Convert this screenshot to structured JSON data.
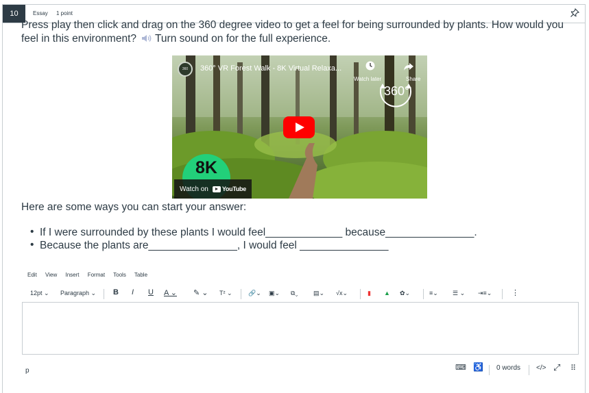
{
  "question": {
    "number": "10",
    "type": "Essay",
    "points": "1 point"
  },
  "prompt": {
    "line1": "Press play then click and drag on the 360 degree video to get a feel for being surrounded by plants.  How would you",
    "line2_a": "feel in this environment?",
    "line2_b": "Turn sound on for the full experience."
  },
  "video": {
    "title": "360° VR Forest Walk - 8K Virtual Relaxa...",
    "channel_badge": "360",
    "watch_later": "Watch later",
    "share": "Share",
    "badge_360": "360°",
    "badge_8k": "8K",
    "watch_on": "Watch on",
    "youtube": "YouTube"
  },
  "starters": {
    "intro": "Here are some ways you can start your answer:",
    "items": [
      "If I were surrounded by these plants I would feel_____________ because_______________.",
      "Because the plants are_______________, I would feel _______________"
    ]
  },
  "editor": {
    "menu": [
      "Edit",
      "View",
      "Insert",
      "Format",
      "Tools",
      "Table"
    ],
    "font_size": "12pt",
    "block_format": "Paragraph",
    "bold": "B",
    "italic": "I",
    "underline": "U",
    "superscript": "T²",
    "more": "⋮",
    "status_path": "p",
    "word_count": "0 words",
    "html_toggle": "</>"
  },
  "colors": {
    "accent": "#2d3b45",
    "border": "#c7cdd1",
    "yt_red": "#ff0000",
    "k8_green": "#22d07a"
  }
}
